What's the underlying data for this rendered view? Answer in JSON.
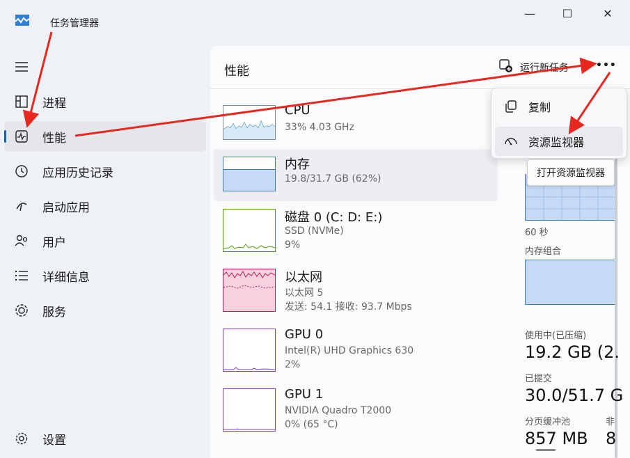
{
  "window": {
    "title": "任务管理器",
    "controls": {
      "minimize": "—",
      "maximize": "☐",
      "close": "✕"
    }
  },
  "sidebar": {
    "menu_icon": "hamburger-icon",
    "items": [
      {
        "label": "进程",
        "icon": "processes-icon"
      },
      {
        "label": "性能",
        "icon": "performance-icon",
        "active": true
      },
      {
        "label": "应用历史记录",
        "icon": "history-icon"
      },
      {
        "label": "启动应用",
        "icon": "startup-icon"
      },
      {
        "label": "用户",
        "icon": "users-icon"
      },
      {
        "label": "详细信息",
        "icon": "details-icon"
      },
      {
        "label": "服务",
        "icon": "services-icon"
      }
    ],
    "settings_label": "设置"
  },
  "header": {
    "title": "性能",
    "run_task_label": "运行新任务",
    "more_label": "•••"
  },
  "perf_list": [
    {
      "title": "CPU",
      "line1": "33%  4.03 GHz",
      "line2": ""
    },
    {
      "title": "内存",
      "line1": "19.8/31.7 GB (62%)",
      "line2": ""
    },
    {
      "title": "磁盘 0 (C: D: E:)",
      "line1": "SSD (NVMe)",
      "line2": "9%"
    },
    {
      "title": "以太网",
      "line1": "以太网 5",
      "line2": "发送: 54.1  接收: 93.7 Mbps"
    },
    {
      "title": "GPU 0",
      "line1": "Intel(R) UHD Graphics 630",
      "line2": "2%"
    },
    {
      "title": "GPU 1",
      "line1": "NVIDIA Quadro T2000",
      "line2": "0% (65 °C)"
    }
  ],
  "context_menu": {
    "items": [
      {
        "label": "复制",
        "icon": "copy-icon"
      },
      {
        "label": "资源监视器",
        "icon": "resource-monitor-icon"
      }
    ],
    "tooltip": "打开资源监视器"
  },
  "detail": {
    "time_label": "60 秒",
    "composition_label": "内存组合",
    "in_use_label": "使用中(已压缩)",
    "in_use_value": "19.2 GB (2.",
    "committed_label": "已提交",
    "committed_value": "30.0/51.7 G",
    "paged_label": "分页缓冲池",
    "paged_value": "857 MB",
    "nonpaged_label": "非",
    "nonpaged_value": "8"
  },
  "colors": {
    "cpu": "#1a7bb0",
    "memory": "#3a7bc8",
    "disk": "#4e9a06",
    "ethernet": "#c2185b",
    "gpu": "#7b3fb5",
    "annotation": "#e8281e"
  }
}
